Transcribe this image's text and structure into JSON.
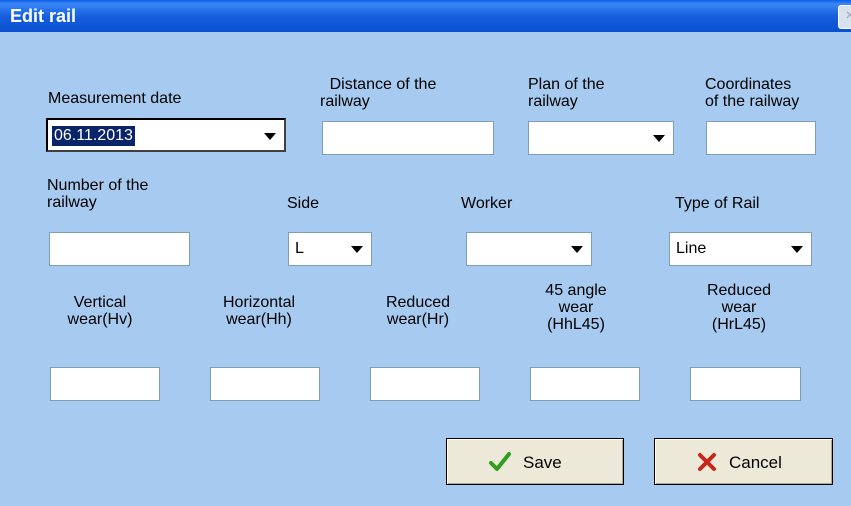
{
  "window": {
    "title": "Edit rail",
    "close_glyph": "×"
  },
  "fields": {
    "measurement_date": {
      "label": "Measurement date",
      "value": "06.11.2013"
    },
    "distance": {
      "label_line1": "Distance of the",
      "label_line2": "railway",
      "value": ""
    },
    "plan": {
      "label_line1": "Plan of the",
      "label_line2": "railway",
      "value": ""
    },
    "coordinates": {
      "label_line1": "Coordinates",
      "label_line2": "of the railway",
      "value": ""
    },
    "number": {
      "label_line1": "Number of the",
      "label_line2": "railway",
      "value": ""
    },
    "side": {
      "label": "Side",
      "value": "L"
    },
    "worker": {
      "label": "Worker",
      "value": ""
    },
    "type_of_rail": {
      "label": "Type of Rail",
      "value": "Line"
    },
    "vertical_wear": {
      "label_line1": "Vertical",
      "label_line2": "wear(Hv)",
      "value": ""
    },
    "horizontal_wear": {
      "label_line1": "Horizontal",
      "label_line2": "wear(Hh)",
      "value": ""
    },
    "reduced_wear": {
      "label_line1": "Reduced",
      "label_line2": "wear(Hr)",
      "value": ""
    },
    "angle_wear": {
      "label_line1": "45 angle",
      "label_line2": "wear",
      "label_line3": "(HhL45)",
      "value": ""
    },
    "reduced_angle_wear": {
      "label_line1": "Reduced",
      "label_line2": "wear",
      "label_line3": "(HrL45)",
      "value": ""
    }
  },
  "buttons": {
    "save_label": "Save",
    "cancel_label": "Cancel"
  },
  "icons": {
    "save": "checkmark-icon",
    "cancel": "red-x-icon",
    "dropdown": "chevron-down-icon"
  },
  "colors": {
    "background": "#a6caf0",
    "titlebar": "#0a5ee8",
    "selection": "#0a246a",
    "save_icon": "#2f9e1f",
    "cancel_icon": "#c8261a"
  }
}
